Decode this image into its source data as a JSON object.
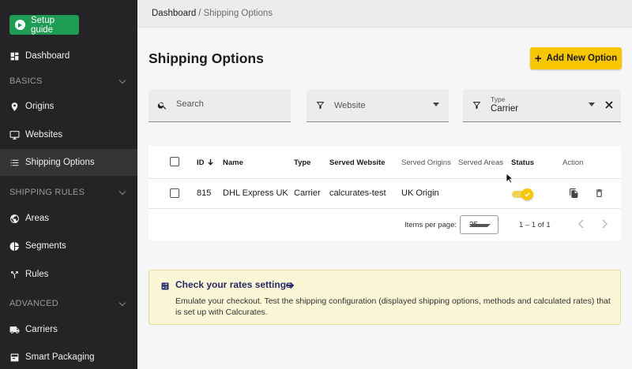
{
  "sidebar": {
    "setup_label": "Setup guide",
    "dashboard": "Dashboard",
    "basics": "BASICS",
    "origins": "Origins",
    "websites": "Websites",
    "shipping_options": "Shipping Options",
    "shipping_rules": "SHIPPING RULES",
    "areas": "Areas",
    "segments": "Segments",
    "rules": "Rules",
    "advanced": "ADVANCED",
    "carriers": "Carriers",
    "smart_packaging": "Smart Packaging"
  },
  "breadcrumb": {
    "home": "Dashboard",
    "sep": "/",
    "current": "Shipping Options"
  },
  "page": {
    "title": "Shipping Options",
    "add_label": "Add New Option"
  },
  "filters": {
    "search_placeholder": "Search",
    "website_placeholder": "Website",
    "type_label": "Type",
    "type_value": "Carrier"
  },
  "table": {
    "headers": {
      "id": "ID",
      "name": "Name",
      "type": "Type",
      "served_website": "Served Website",
      "served_origins": "Served Origins",
      "served_areas": "Served Areas",
      "status": "Status",
      "action": "Action"
    },
    "row": {
      "id": "815",
      "name": "DHL Express UK",
      "type": "Carrier",
      "website": "calcurates-test",
      "origins": "UK Origin",
      "areas": "",
      "status_on": true
    },
    "footer": {
      "items_per_page_label": "Items per page:",
      "per_page": "25",
      "range": "1 – 1 of 1"
    }
  },
  "info": {
    "title": "Check your rates settings",
    "text": "Emulate your checkout. Test the shipping configuration (displayed shipping options, methods and calculated rates) that is set up with Calcurates."
  },
  "colors": {
    "accent": "#f8c600",
    "sidebar": "#242426",
    "setup": "#1f9d55",
    "info_bg": "#fbf6d6"
  }
}
